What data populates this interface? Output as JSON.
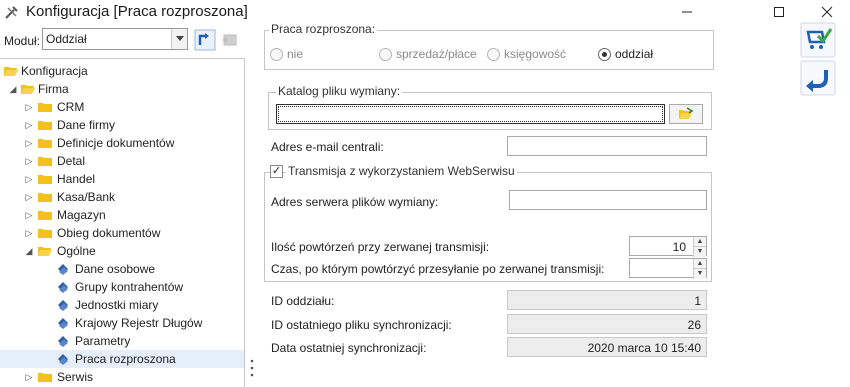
{
  "window": {
    "title": "Konfiguracja [Praca rozproszona]"
  },
  "module": {
    "label": "Moduł:",
    "selected": "Oddział"
  },
  "tree": {
    "root": "Konfiguracja",
    "firma": "Firma",
    "items": [
      "CRM",
      "Dane firmy",
      "Definicje dokumentów",
      "Detal",
      "Handel",
      "Kasa/Bank",
      "Magazyn",
      "Obieg dokumentów",
      "Ogólne"
    ],
    "ogolne_children": [
      "Dane osobowe",
      "Grupy kontrahentów",
      "Jednostki miary",
      "Krajowy Rejestr Długów",
      "Parametry",
      "Praca rozproszona"
    ],
    "serwis": "Serwis"
  },
  "praca": {
    "legend": "Praca rozproszona:",
    "options": [
      "nie",
      "sprzedaż/płace",
      "księgowość",
      "oddział"
    ],
    "selected": "oddział"
  },
  "katalog": {
    "legend": "Katalog pliku wymiany:",
    "value": ""
  },
  "email": {
    "label": "Adres e-mail centrali:",
    "value": ""
  },
  "webservice": {
    "checkbox_label": "Transmisja z wykorzystaniem WebSerwisu",
    "checked": true,
    "server_label": "Adres serwera plików wymiany:",
    "server_value": "",
    "retries_label": "Ilość powtórzeń przy zerwanej transmisji:",
    "retries_value": "10",
    "retry_time_label": "Czas, po którym powtórzyć przesyłanie po zerwanej transmisji:",
    "retry_time_value": ""
  },
  "info": {
    "branch_id_label": "ID oddziału:",
    "branch_id_value": "1",
    "last_sync_file_label": "ID ostatniego pliku synchronizacji:",
    "last_sync_file_value": "26",
    "last_sync_date_label": "Data ostatniej synchronizacji:",
    "last_sync_date_value": "2020 marca 10 15:40"
  },
  "colors": {
    "folder": "#f2c21a",
    "accent_blue": "#1f5fb4",
    "selected_row": "#e5eefb"
  }
}
